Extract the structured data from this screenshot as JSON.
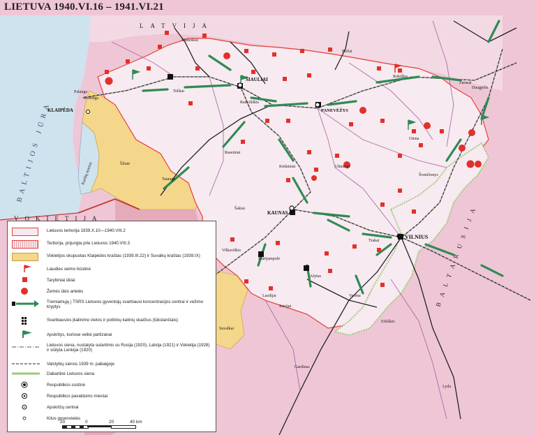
{
  "title": "LIETUVA 1940.VI.16 – 1941.VI.21",
  "colors": {
    "lithuania": "#f7eaf0",
    "pink_neighbor": "#efc6d6",
    "latvia": "#f3d9e3",
    "klaipeda_yellow": "#f4d78a",
    "border_red": "#e2413a",
    "green": "#2f8a55",
    "sea": "#cfe3ee",
    "mauve_border": "#b070b0"
  },
  "sea_label": "BALTIJOS JŪRA",
  "bay_label": "Kuršių marios",
  "country_labels": {
    "vokietija": "VOKIETIJA",
    "baltarusija": "BALTARUSIJA",
    "latvija": "LATVIJA"
  },
  "cities": {
    "vilnius": "VILNIUS",
    "kaunas": "KAUNAS",
    "siauliai": "ŠIAULIAI",
    "panevezys": "PANEVĖŽYS",
    "klaipeda": "KLAIPĖDA",
    "telsiai": "Telšiai",
    "mazeikiai": "Mažeikiai",
    "birzai": "Biržai",
    "rokiskis": "Rokiškis",
    "utena": "Utena",
    "ukmerge": "Ukmergė",
    "kedainiai": "Kėdainiai",
    "raseiniai": "Raseiniai",
    "taurage": "Tauragė",
    "sakiai": "Šakiai",
    "marijampole": "Marijampolė",
    "vilkaviskis": "Vilkaviškis",
    "alytus": "Alytus",
    "trakai": "Trakai",
    "lazdijai": "Lazdijai",
    "kretinga": "Kretinga",
    "palanga": "Palanga",
    "silute": "Šilutė",
    "radviliskis": "Radviliškis",
    "svencionys": "Švenčionys",
    "zarasai": "Zarasai",
    "seirijai": "Seirijai",
    "varena": "Varėna",
    "suvalkai": "Suvalkai",
    "gardinas": "Gardinas",
    "daugpilis": "Daugpilis",
    "lyda": "Lyda",
    "eisiskes": "Eišiškės"
  },
  "legend": {
    "items": [
      "Lietuvos teritorija 1939.X.10—1940.VIII.2",
      "Teritorija, prijungta prie Lietuvos 1940.VIII.3",
      "Vokietijos okupuotas Klaipėdos kraštas (1939.III.22) ir Suvalkų kraštas (1939.IX)",
      "Liaudies seimo būstinė",
      "Tarybiniai ūkiai",
      "Žemės ūkio artelės",
      "Tremiamųjų į TSRS Lietuvos gyventojų svarbiausi koncentracijos centrai ir vežimo kryptys",
      "Svarbiausios įkalinimo vietos ir politinių kalinių skaičius (tūkstančiais)",
      "Apskritys, kuriose veikė partizanai",
      "Lietuvos siena, nustatyta sutartimis su Rusija (1920), Latvija (1921) ir Vokietija (1928) ir siūlyta Lenkijai (1920)",
      "Valstybių sienos 1939 m. pabaigoje",
      "Dabartinė Lietuvos siena",
      "Respublikos sostinė",
      "Respublikos pavaldumo miestai",
      "Apskričių centrai",
      "Kitos gyvenvietės"
    ]
  },
  "scale": {
    "ticks": [
      "20",
      "0",
      "20",
      "40 km"
    ]
  }
}
